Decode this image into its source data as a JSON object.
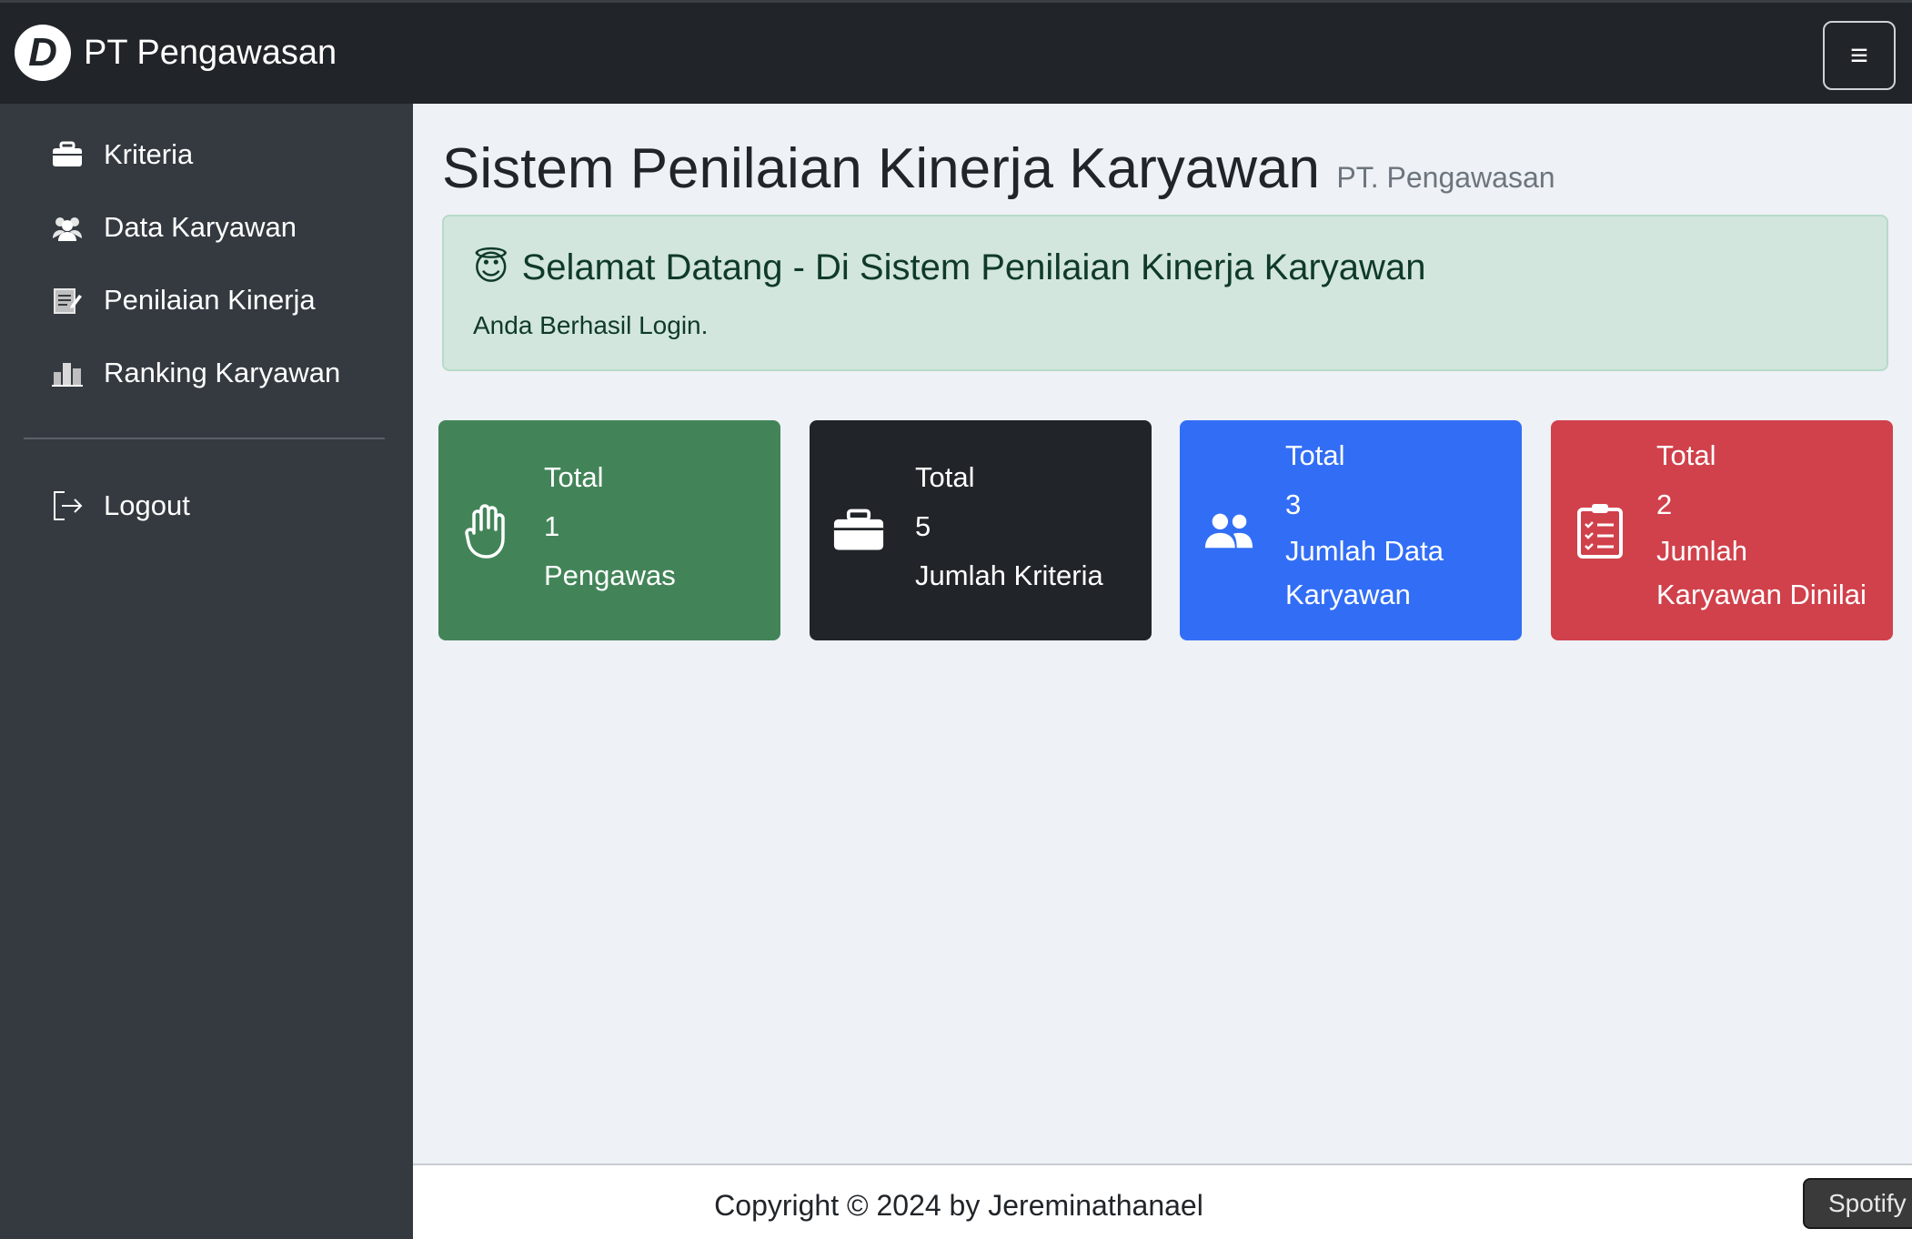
{
  "navbar": {
    "logo_letter": "D",
    "brand": "PT Pengawasan",
    "toggle_glyph": "≡"
  },
  "sidebar": {
    "items": [
      {
        "label": "Kriteria",
        "icon": "toolbox-icon"
      },
      {
        "label": "Data Karyawan",
        "icon": "users-icon"
      },
      {
        "label": "Penilaian Kinerja",
        "icon": "edit-document-icon"
      },
      {
        "label": "Ranking Karyawan",
        "icon": "building-chart-icon"
      }
    ],
    "logout": {
      "label": "Logout",
      "icon": "logout-icon"
    }
  },
  "main": {
    "title": "Sistem Penilaian Kinerja Karyawan",
    "subtitle": "PT. Pengawasan",
    "alert": {
      "emoji": "😇",
      "title": "Selamat Datang - Di Sistem Penilaian Kinerja Karyawan",
      "text": "Anda Berhasil Login."
    },
    "cards": [
      {
        "line1": "Total",
        "value": "1",
        "line3": "Pengawas",
        "line4": "",
        "color": "#428458",
        "icon": "hand-icon"
      },
      {
        "line1": "Total",
        "value": "5",
        "line3": "Jumlah Kriteria",
        "line4": "",
        "color": "#212529",
        "icon": "toolbox-icon"
      },
      {
        "line1": "Total",
        "value": "3",
        "line3": "Jumlah Data",
        "line4": "Karyawan",
        "color": "#326ef5",
        "icon": "users-icon"
      },
      {
        "line1": "Total",
        "value": "2",
        "line3": "Jumlah",
        "line4": "Karyawan Dinilai",
        "color": "#d0414b",
        "icon": "clipboard-list-icon"
      }
    ]
  },
  "footer": {
    "copyright": "Copyright © 2024 by Jereminathanael",
    "popup": "Spotify"
  }
}
